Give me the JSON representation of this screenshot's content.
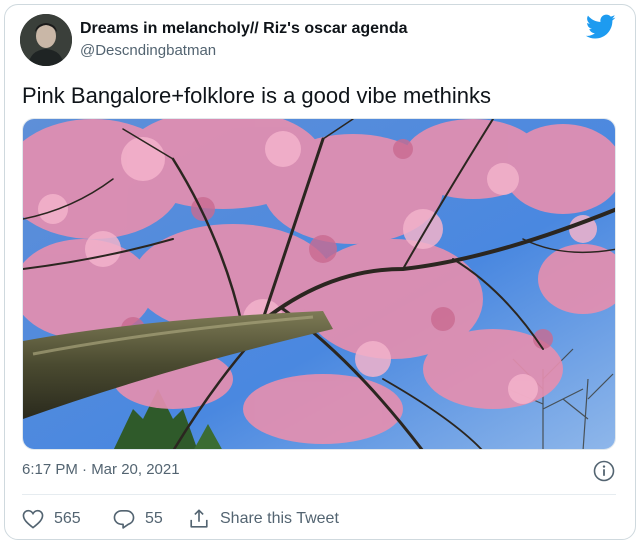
{
  "tweet": {
    "display_name": "Dreams in melancholy// Riz's oscar agenda",
    "handle": "@Descndingbatman",
    "text": "Pink Bangalore+folklore is a good vibe methinks",
    "timestamp": "6:17 PM · Mar 20, 2021"
  },
  "actions": {
    "like_count": "565",
    "reply_count": "55",
    "share_label": "Share this Tweet"
  },
  "icons": {
    "brand": "twitter-bird-icon",
    "info": "info-icon",
    "like": "heart-icon",
    "reply": "reply-bubble-icon",
    "share": "share-icon"
  },
  "colors": {
    "brand_blue": "#1d9bf0",
    "text_primary": "#0f1419",
    "text_secondary": "#536471",
    "border": "#cfd9de"
  }
}
